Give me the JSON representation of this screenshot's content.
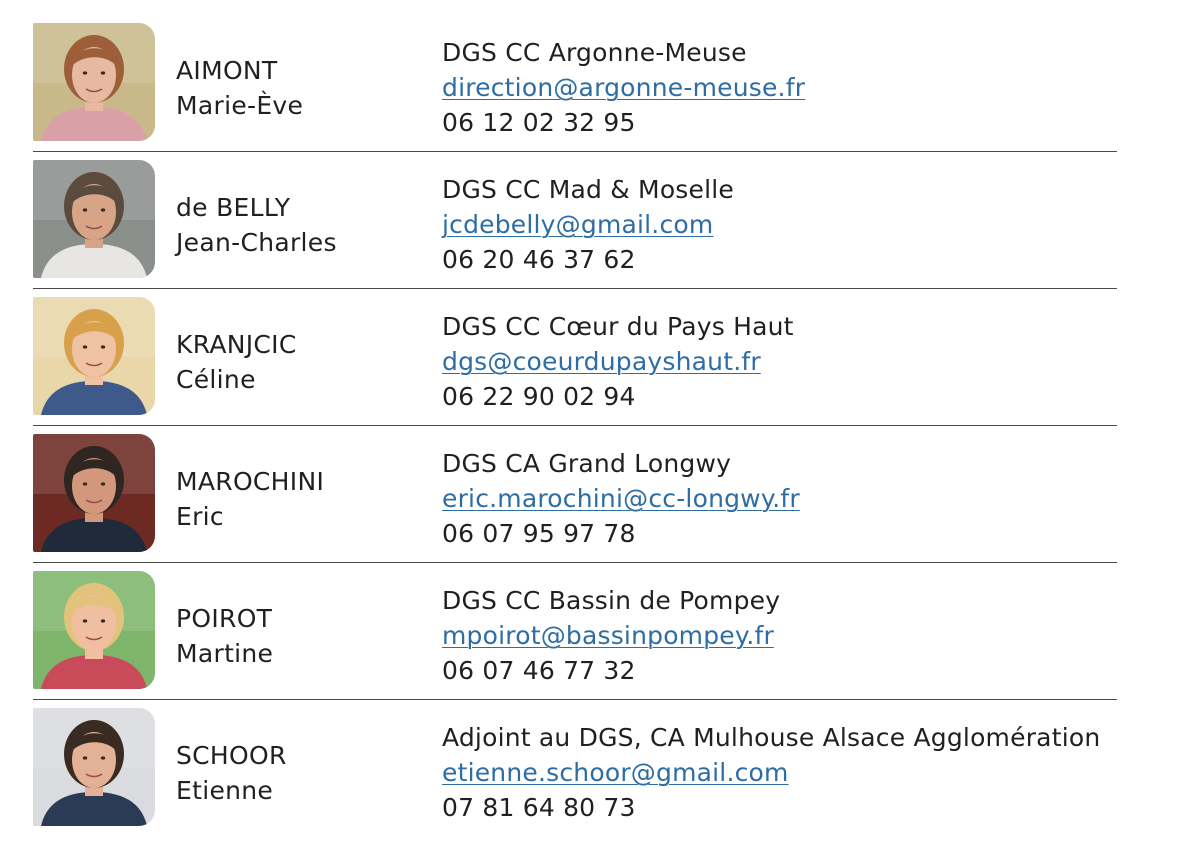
{
  "contacts": [
    {
      "last_name": "AIMONT",
      "first_name": "Marie-Ève",
      "role": "DGS CC Argonne-Meuse",
      "email": "direction@argonne-meuse.fr",
      "phone": "06 12 02 32 95",
      "photo_bg": "#c9b98a",
      "skin": "#e7b9a0",
      "hair": "#9c5f3a",
      "shirt": "#d9a0a8"
    },
    {
      "last_name": "de BELLY",
      "first_name": "Jean-Charles",
      "role": "DGS CC Mad & Moselle",
      "email": "jcdebelly@gmail.com",
      "phone": "06 20 46 37 62",
      "photo_bg": "#8b8f8c",
      "skin": "#d8a488",
      "hair": "#5b4a3e",
      "shirt": "#e8e6e2"
    },
    {
      "last_name": "KRANJCIC",
      "first_name": "Céline",
      "role": "DGS CC Cœur du Pays Haut",
      "email": "dgs@coeurdupayshaut.fr",
      "phone": "06 22 90 02 94",
      "photo_bg": "#e9d6a9",
      "skin": "#f0c2a4",
      "hair": "#d9a04c",
      "shirt": "#3d5a8a"
    },
    {
      "last_name": "MAROCHINI",
      "first_name": "Eric",
      "role": "DGS CA Grand Longwy",
      "email": "eric.marochini@cc-longwy.fr",
      "phone": "06 07 95 97 78",
      "photo_bg": "#6d2a22",
      "skin": "#d3987c",
      "hair": "#2f2622",
      "shirt": "#1f2a3a"
    },
    {
      "last_name": "POIROT",
      "first_name": "Martine",
      "role": "DGS CC Bassin de Pompey",
      "email": "mpoirot@bassinpompey.fr",
      "phone": "06 07 46 77 32",
      "photo_bg": "#7fb56a",
      "skin": "#f0bfa2",
      "hair": "#e3c27e",
      "shirt": "#c94b5a"
    },
    {
      "last_name": "SCHOOR",
      "first_name": "Etienne",
      "role": "Adjoint au DGS, CA Mulhouse Alsace Agglomération",
      "email": "etienne.schoor@gmail.com",
      "phone": "07 81 64 80 73",
      "photo_bg": "#d9dbde",
      "skin": "#e3b296",
      "hair": "#3a2b22",
      "shirt": "#2b3a55"
    }
  ],
  "colors": {
    "text": "#231f20",
    "link": "#2e6da4",
    "divider": "#4a4a4a"
  }
}
